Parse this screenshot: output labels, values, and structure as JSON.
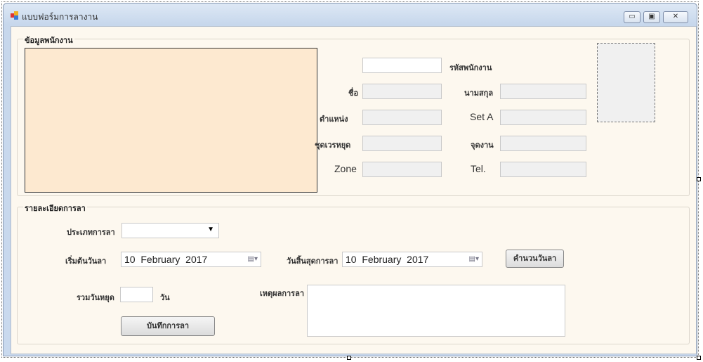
{
  "window": {
    "title": "แบบฟอร์มการลางาน",
    "minimize": "▭",
    "maximize": "▣",
    "close": "✕"
  },
  "employee_group": {
    "title": "ข้อมูลพนักงาน",
    "labels": {
      "employee_id": "รหัสพนักงาน",
      "first_name": "ชื่อ",
      "last_name": "นามสกุล",
      "position": "ตำแหน่ง",
      "set": "Set A",
      "shift": "ชุดเวรหยุด",
      "workpoint": "จุดงาน",
      "zone": "Zone",
      "tel": "Tel."
    }
  },
  "leave_group": {
    "title": "รายละเอียดการลา",
    "leave_type_label": "ประเภทการลา",
    "start_label": "เริ่มต้นวันลา",
    "start_date": "10  February  2017",
    "end_label": "วันสิ้นสุดการลา",
    "end_date": "10  February  2017",
    "calc_button": "คำนวนวันลา",
    "total_label": "รวมวันหยุด",
    "days_unit": "วัน",
    "reason_label": "เหตุผลการลา",
    "save_button": "บันทึกการลา"
  },
  "colors": {
    "photo_panel": "#fde9d0",
    "form_bg": "#fdf8ef"
  }
}
